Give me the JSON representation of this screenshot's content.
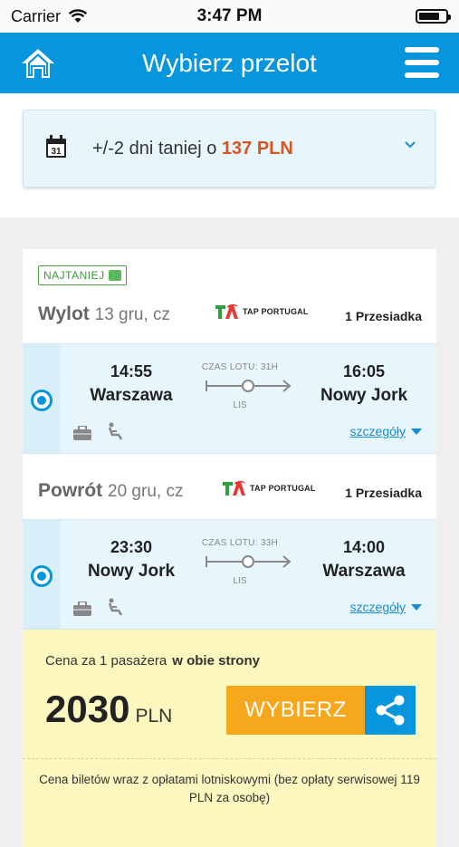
{
  "status_bar": {
    "carrier": "Carrier",
    "time": "3:47 PM"
  },
  "header": {
    "title": "Wybierz przelot"
  },
  "date_banner": {
    "calendar_day": "31",
    "text": "+/-2 dni taniej o",
    "price": "137 PLN"
  },
  "offer": {
    "badge": "NAJTANIEJ",
    "outbound": {
      "direction": "Wylot",
      "date": "13 gru, cz",
      "airline": "TAP PORTUGAL",
      "stops": "1 Przesiadka",
      "depart_time": "14:55",
      "depart_city": "Warszawa",
      "arrive_time": "16:05",
      "arrive_city": "Nowy Jork",
      "duration": "CZAS LOTU: 31H",
      "via": "LIS",
      "details": "szczegóły"
    },
    "return": {
      "direction": "Powrót",
      "date": "20 gru, cz",
      "airline": "TAP PORTUGAL",
      "stops": "1 Przesiadka",
      "depart_time": "23:30",
      "depart_city": "Nowy Jork",
      "arrive_time": "14:00",
      "arrive_city": "Warszawa",
      "duration": "CZAS LOTU: 33H",
      "via": "LIS",
      "details": "szczegóły"
    },
    "price": {
      "label": "Cena za 1 pasażera",
      "label_bold": "w obie strony",
      "amount": "2030",
      "currency": "PLN",
      "select_label": "WYBIERZ",
      "fee_note": "Cena biletów wraz z opłatami lotniskowymi (bez opłaty serwisowej 119 PLN za osobę)"
    }
  },
  "colors": {
    "brand_blue": "#0796dd",
    "price_orange": "#d8541e",
    "select_orange": "#f7a71c",
    "badge_green": "#3a9a3a"
  }
}
